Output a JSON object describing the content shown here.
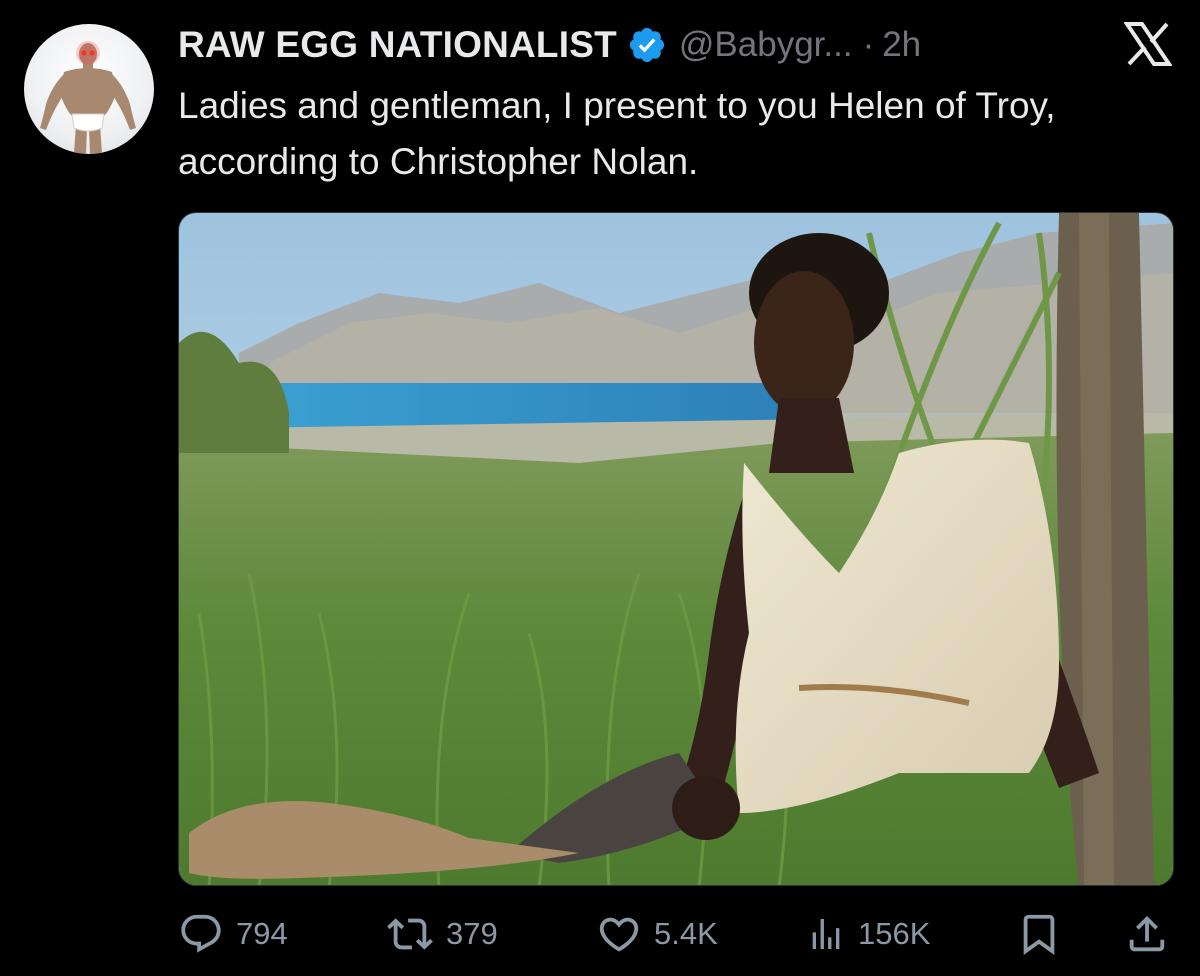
{
  "tweet": {
    "display_name": "RAW EGG NATIONALIST",
    "handle": "@Babygr...",
    "separator": "·",
    "time": "2h",
    "text": "Ladies and gentleman, I present to you Helen of Troy, according to Christopher Nolan.",
    "verified": true
  },
  "metrics": {
    "replies": "794",
    "retweets": "379",
    "likes": "5.4K",
    "views": "156K"
  },
  "icons": {
    "reply": "reply-icon",
    "retweet": "retweet-icon",
    "like": "heart-icon",
    "views": "views-icon",
    "bookmark": "bookmark-icon",
    "share": "share-icon",
    "brand": "x-logo-icon",
    "verified": "verified-badge-icon"
  },
  "colors": {
    "background": "#000000",
    "text": "#e7e9ea",
    "secondary": "#71767b",
    "action": "#8b98a5",
    "verified": "#1d9bf0"
  }
}
